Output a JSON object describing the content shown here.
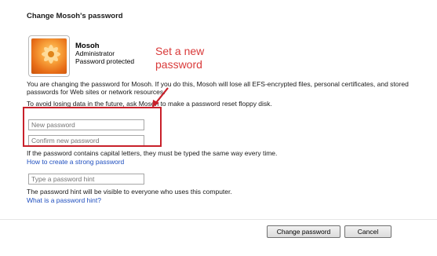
{
  "dialog": {
    "title": "Change Mosoh's password"
  },
  "user": {
    "name": "Mosoh",
    "role": "Administrator",
    "status": "Password protected"
  },
  "annotation": {
    "text": "Set a new password"
  },
  "info": {
    "text": "You are changing the password for Mosoh.  If you do this, Mosoh will lose all EFS-encrypted files, personal certificates, and stored passwords for Web sites or network resources.",
    "tip": "To avoid losing data in the future, ask Mosoh to make a password reset floppy disk."
  },
  "fields": {
    "new_password_placeholder": "New password",
    "confirm_password_placeholder": "Confirm new password",
    "hint_placeholder": "Type a password hint"
  },
  "caps_note": "If the password contains capital letters, they must be typed the same way every time.",
  "links": {
    "strong_password": "How to create a strong password",
    "hint_help": "What is a password hint?"
  },
  "hint_note": "The password hint will be visible to everyone who uses this computer.",
  "buttons": {
    "change": "Change password",
    "cancel": "Cancel"
  },
  "colors": {
    "annotation": "#d93a3a",
    "link": "#1f4fbf",
    "highlight": "#c8202a"
  }
}
